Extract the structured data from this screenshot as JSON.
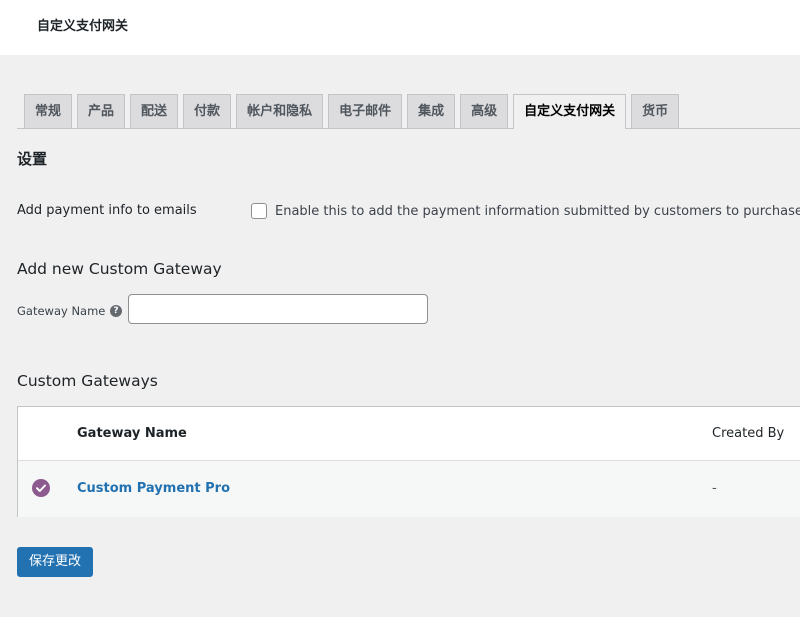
{
  "header": {
    "title": "自定义支付网关"
  },
  "tabs": [
    {
      "label": "常规",
      "active": false
    },
    {
      "label": "产品",
      "active": false
    },
    {
      "label": "配送",
      "active": false
    },
    {
      "label": "付款",
      "active": false
    },
    {
      "label": "帐户和隐私",
      "active": false
    },
    {
      "label": "电子邮件",
      "active": false
    },
    {
      "label": "集成",
      "active": false
    },
    {
      "label": "高级",
      "active": false
    },
    {
      "label": "自定义支付网关",
      "active": true
    },
    {
      "label": "货币",
      "active": false
    }
  ],
  "settings": {
    "title": "设置",
    "email_option": {
      "label": "Add payment info to emails",
      "checked": false,
      "description": "Enable this to add the payment information submitted by customers to purchase Wo"
    }
  },
  "add_gateway": {
    "title": "Add new Custom Gateway",
    "field_label": "Gateway Name",
    "help_icon": "question-circle-icon",
    "value": "",
    "placeholder": ""
  },
  "gateways": {
    "title": "Custom Gateways",
    "columns": {
      "name": "Gateway Name",
      "created_by": "Created By"
    },
    "rows": [
      {
        "status_icon": "check-circle-icon",
        "status_color": "#8c5a8f",
        "name": "Custom Payment Pro",
        "created_by": "-"
      }
    ]
  },
  "actions": {
    "save_label": "保存更改"
  },
  "colors": {
    "primary": "#2271b1",
    "active_status": "#8c5a8f",
    "background": "#f0f0f1"
  }
}
